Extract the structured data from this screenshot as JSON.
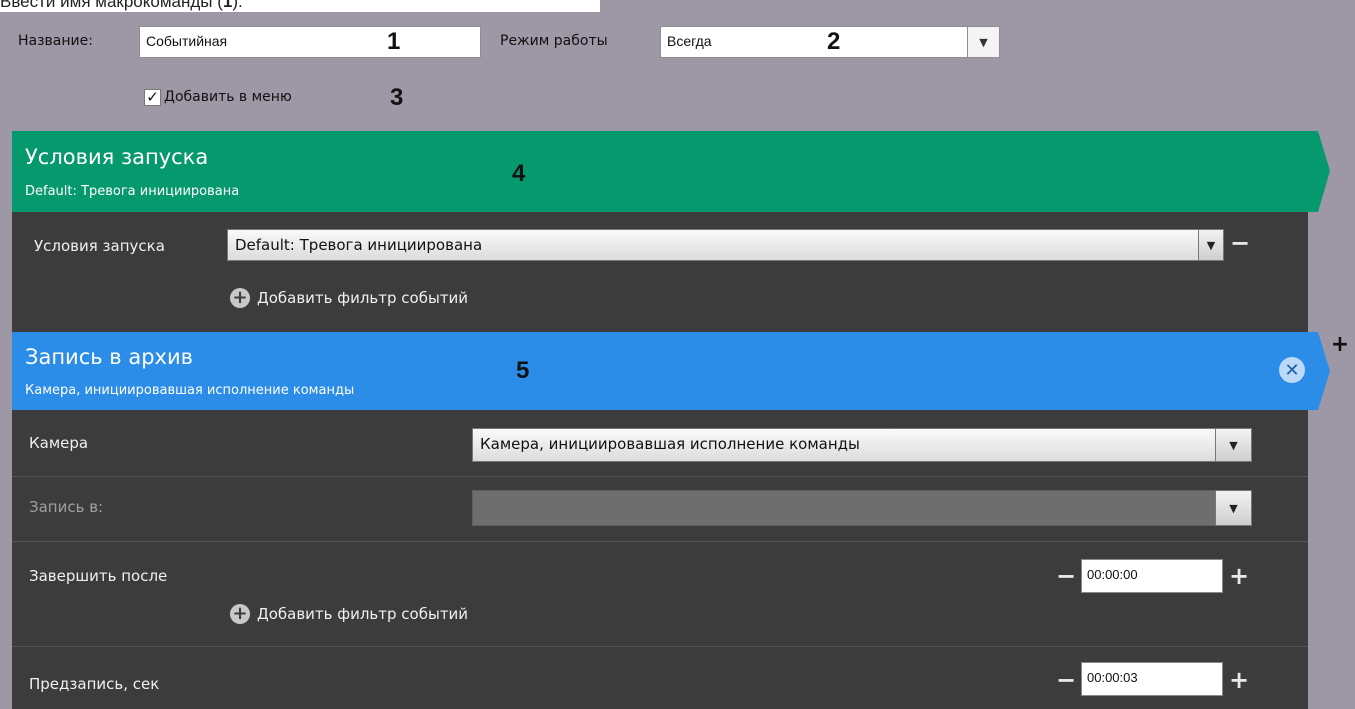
{
  "caption": {
    "prefix": "Ввести имя макрокоманды (",
    "bold": "1",
    "suffix": ")."
  },
  "header": {
    "name_label": "Название:",
    "name_value": "Событийная",
    "mode_label": "Режим работы",
    "mode_value": "Всегда",
    "add_to_menu_label": "Добавить в меню",
    "add_to_menu_checked": true
  },
  "badges": {
    "b1": "1",
    "b2": "2",
    "b3": "3",
    "b4": "4",
    "b5": "5"
  },
  "trigger_section": {
    "title": "Условия запуска",
    "subtitle": "Default: Тревога инициирована",
    "color": "#07996e",
    "condition_label": "Условия запуска",
    "condition_value": "Default: Тревога инициирована",
    "add_filter_label": "Добавить фильтр событий"
  },
  "action_section": {
    "title": "Запись в архив",
    "subtitle": "Камера, инициировавшая исполнение команды",
    "color": "#2b8de8",
    "camera_label": "Камера",
    "camera_value": "Камера, инициировавшая исполнение команды",
    "record_to_label": "Запись в:",
    "record_to_value": "",
    "finish_after_label": "Завершить после",
    "finish_after_value": "00:00:00",
    "add_filter_label": "Добавить фильтр событий",
    "prerecord_label": "Предзапись, сек",
    "prerecord_value": "00:00:03"
  },
  "colors": {
    "background": "#9e97a5",
    "panel": "#3c3c3c",
    "trigger": "#07996e",
    "action": "#2b8de8"
  },
  "icons": {
    "dropdown": "caret-down-icon",
    "remove": "minus-icon",
    "add": "plus-icon",
    "close": "close-circle-icon",
    "add_filter": "plus-circle-icon"
  }
}
